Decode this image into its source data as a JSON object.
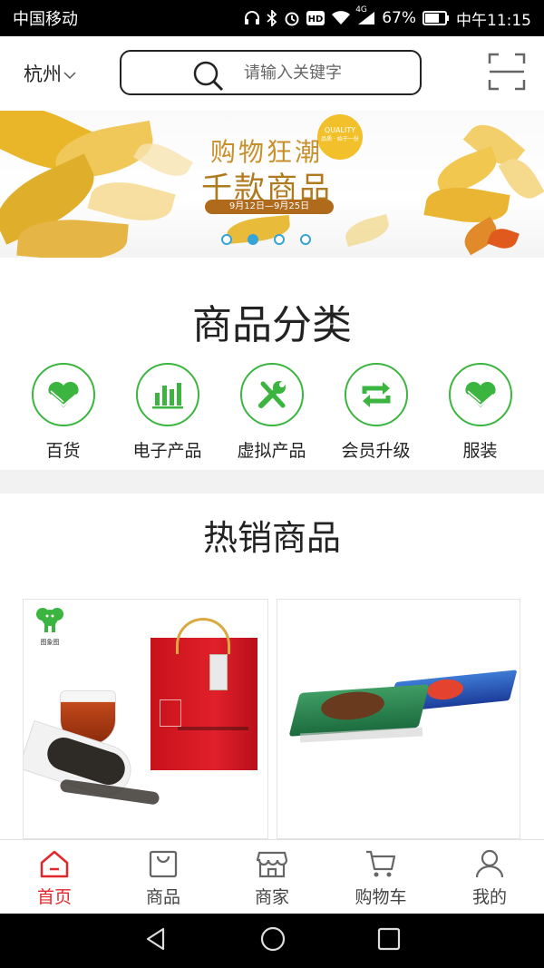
{
  "status_bar": {
    "carrier": "中国移动",
    "network": "4G",
    "battery": "67%",
    "time": "中午11:15"
  },
  "header": {
    "city": "杭州",
    "search_placeholder": "请输入关键字"
  },
  "banner": {
    "line1": "购物狂潮",
    "line2": "千款商品",
    "date": "9月12日—9月25日",
    "badge_title": "QUALITY",
    "badge_sub": "品质 · 始于一份",
    "slide_count": 4,
    "active_slide": 1
  },
  "categories": {
    "title": "商品分类",
    "items": [
      {
        "label": "百货",
        "icon": "heart-icon"
      },
      {
        "label": "电子产品",
        "icon": "bar-chart-icon"
      },
      {
        "label": "虚拟产品",
        "icon": "tools-icon"
      },
      {
        "label": "会员升级",
        "icon": "refresh-icon"
      },
      {
        "label": "服装",
        "icon": "heart-icon"
      }
    ]
  },
  "hot": {
    "title": "热销商品",
    "products": [
      {
        "brand": "图象图",
        "desc": "red tea gift set"
      },
      {
        "desc": "tin gift boxes"
      }
    ]
  },
  "tabbar": {
    "items": [
      {
        "label": "首页",
        "icon": "home-icon",
        "active": true
      },
      {
        "label": "商品",
        "icon": "bag-icon",
        "active": false
      },
      {
        "label": "商家",
        "icon": "store-icon",
        "active": false
      },
      {
        "label": "购物车",
        "icon": "cart-icon",
        "active": false
      },
      {
        "label": "我的",
        "icon": "user-icon",
        "active": false
      }
    ]
  },
  "colors": {
    "accent_green": "#3bb53f",
    "active_red": "#e3262b",
    "dot_blue": "#36a3d9"
  }
}
